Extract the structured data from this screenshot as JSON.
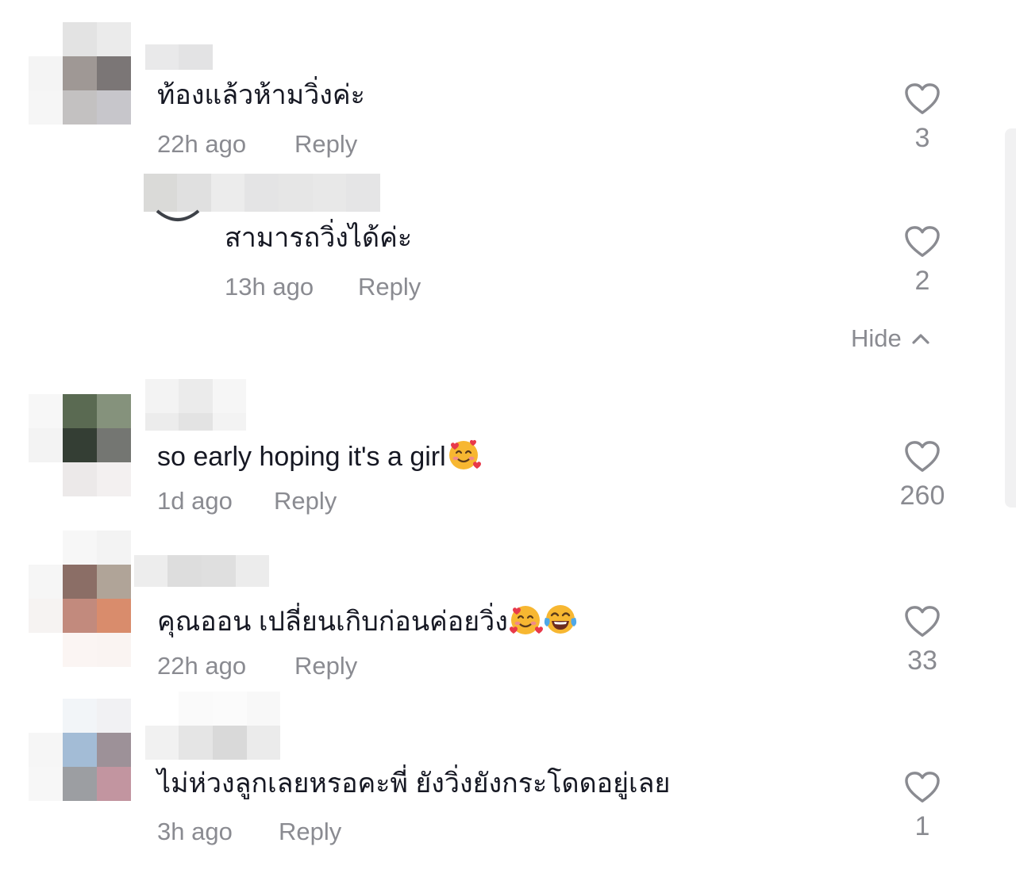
{
  "comments": [
    {
      "text": "ท้องแล้วห้ามวิ่งค่ะ",
      "time": "22h ago",
      "reply_label": "Reply",
      "like_count": "3"
    },
    {
      "text": "สามารถวิ่งได้ค่ะ",
      "time": "13h ago",
      "reply_label": "Reply",
      "like_count": "2"
    },
    {
      "text": "so early hoping it's a girl",
      "time": "1d ago",
      "reply_label": "Reply",
      "like_count": "260"
    },
    {
      "text": "คุณออน เปลี่ยนเกิบก่อนค่อยวิ่ง",
      "time": "22h ago",
      "reply_label": "Reply",
      "like_count": "33"
    },
    {
      "text": "ไม่ห่วงลูกเลยหรอคะพี่ ยังวิ่งยังกระโดดอยู่เลย",
      "time": "3h ago",
      "reply_label": "Reply",
      "like_count": "1"
    }
  ],
  "replies_toggle": {
    "label": "Hide",
    "icon": "chevron-up-icon"
  },
  "icons": {
    "like": "heart-outline-icon",
    "emoji_smiling_hearts": "smiling-face-with-hearts-icon",
    "emoji_tears_of_joy": "face-with-tears-of-joy-icon"
  },
  "colors": {
    "text_primary": "#161823",
    "text_secondary": "#8a8b91",
    "background": "#ffffff"
  }
}
